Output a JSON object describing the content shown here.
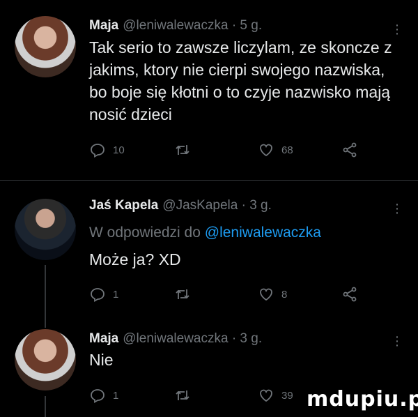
{
  "tweets": [
    {
      "name": "Maja",
      "handle": "@leniwalewaczka",
      "time": "· 5 g.",
      "reply_prefix": "",
      "reply_to": "",
      "text": "Tak serio to zawsze liczylam, ze skoncze z jakims, ktory nie cierpi swojego nazwiska, bo boje się kłotni o to czyje nazwisko mają nosić dzieci",
      "replies": "10",
      "retweets": "",
      "likes": "68"
    },
    {
      "name": "Jaś Kapela",
      "handle": "@JasKapela",
      "time": "· 3 g.",
      "reply_prefix": "W odpowiedzi do",
      "reply_to": "@leniwalewaczka",
      "text": "Może ja? XD",
      "replies": "1",
      "retweets": "",
      "likes": "8"
    },
    {
      "name": "Maja",
      "handle": "@leniwalewaczka",
      "time": "· 3 g.",
      "reply_prefix": "",
      "reply_to": "",
      "text": "Nie",
      "replies": "1",
      "retweets": "",
      "likes": "39"
    }
  ],
  "watermark": "mdupiu.pl",
  "icons": [
    "reply-icon",
    "retweet-icon",
    "like-icon",
    "share-icon",
    "more-icon"
  ],
  "colors": {
    "background": "#000000",
    "text": "#e7e9ea",
    "muted": "#71767b",
    "link": "#1d9bf0"
  }
}
